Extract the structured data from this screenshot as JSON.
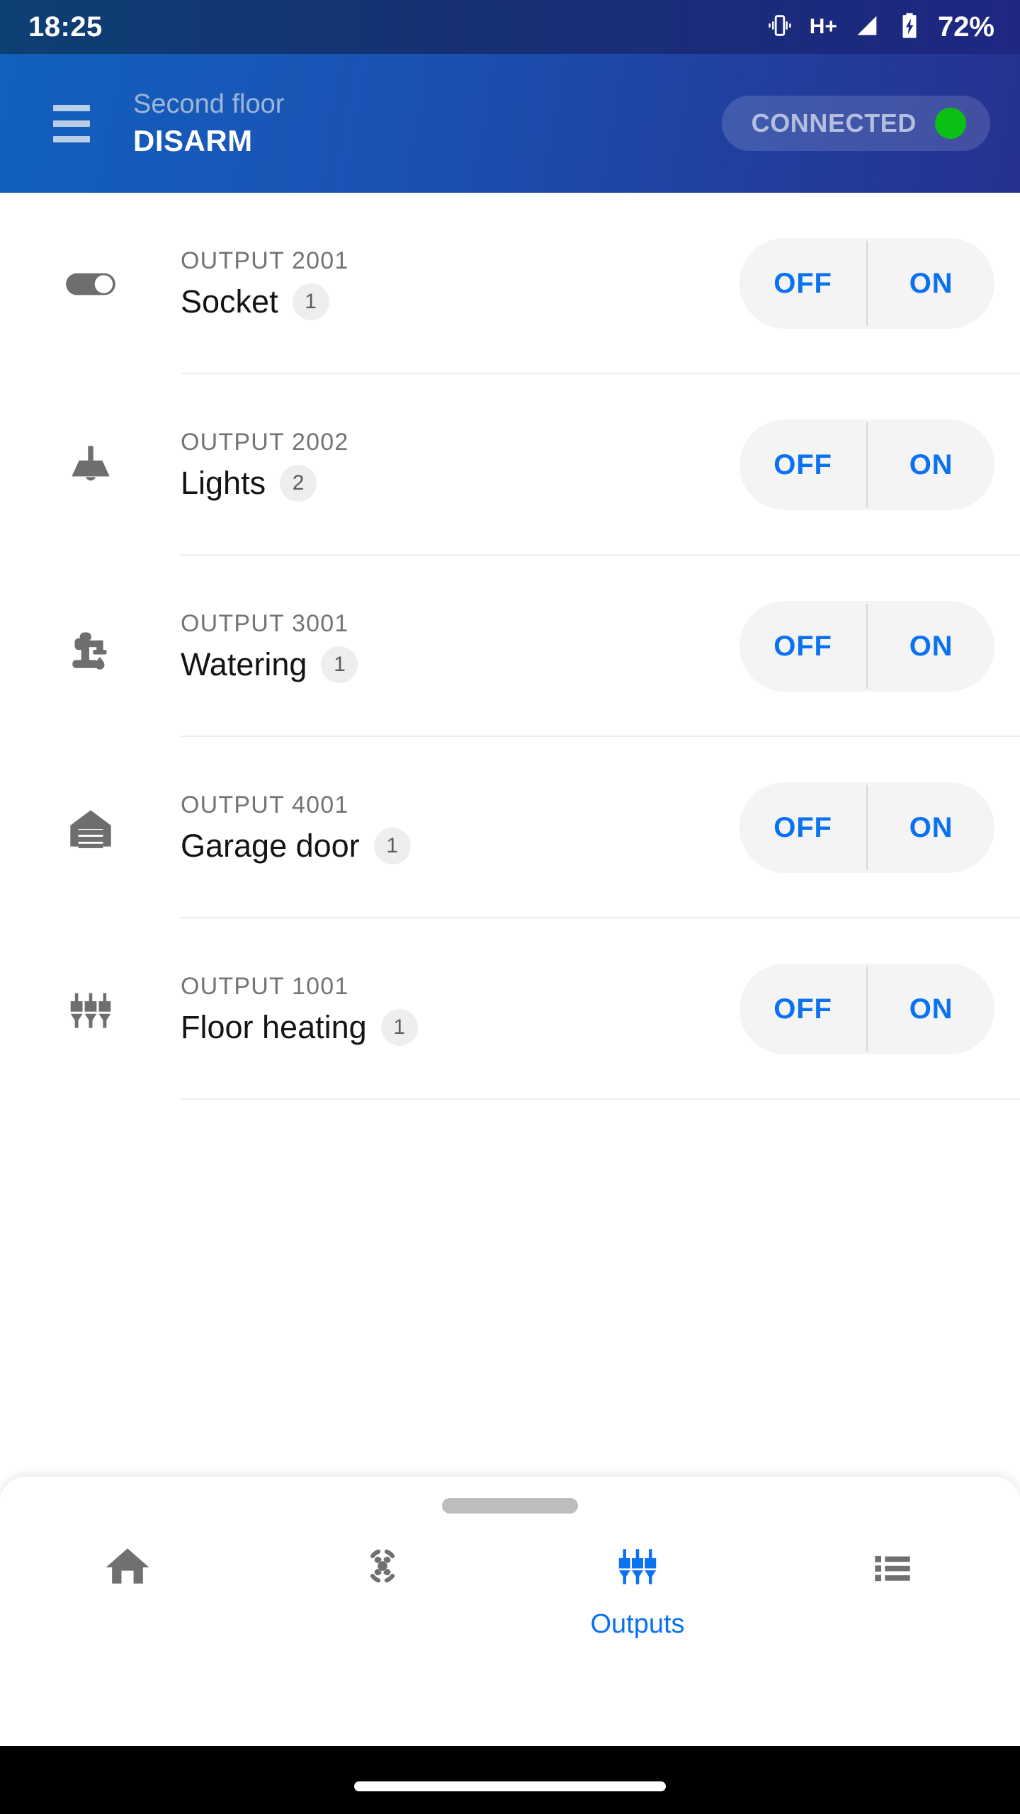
{
  "status_bar": {
    "time": "18:25",
    "network_type": "H+",
    "battery_percent": "72%",
    "icons": [
      "vibrate-icon",
      "signal-icon",
      "battery-charging-icon"
    ]
  },
  "app_bar": {
    "menu_icon": "hamburger-menu-icon",
    "subtitle": "Second floor",
    "title": "DISARM",
    "connection": {
      "label": "CONNECTED",
      "dot_color": "#0bbf13"
    }
  },
  "outputs": [
    {
      "icon": "toggle-switch-icon",
      "output_id": "OUTPUT 2001",
      "name": "Socket",
      "badge": "1",
      "off_label": "OFF",
      "on_label": "ON"
    },
    {
      "icon": "ceiling-lamp-icon",
      "output_id": "OUTPUT 2002",
      "name": "Lights",
      "badge": "2",
      "off_label": "OFF",
      "on_label": "ON"
    },
    {
      "icon": "water-tap-icon",
      "output_id": "OUTPUT 3001",
      "name": "Watering",
      "badge": "1",
      "off_label": "OFF",
      "on_label": "ON"
    },
    {
      "icon": "garage-door-icon",
      "output_id": "OUTPUT 4001",
      "name": "Garage door",
      "badge": "1",
      "off_label": "OFF",
      "on_label": "ON"
    },
    {
      "icon": "outputs-connector-icon",
      "output_id": "OUTPUT 1001",
      "name": "Floor heating",
      "badge": "1",
      "off_label": "OFF",
      "on_label": "ON"
    }
  ],
  "bottom_nav": {
    "items": [
      {
        "icon": "home-icon",
        "label": "",
        "active": false
      },
      {
        "icon": "motion-sensor-icon",
        "label": "",
        "active": false
      },
      {
        "icon": "outputs-connector-icon",
        "label": "Outputs",
        "active": true
      },
      {
        "icon": "list-icon",
        "label": "",
        "active": false
      }
    ],
    "active_color": "#0a72f0",
    "inactive_color": "#707070"
  }
}
